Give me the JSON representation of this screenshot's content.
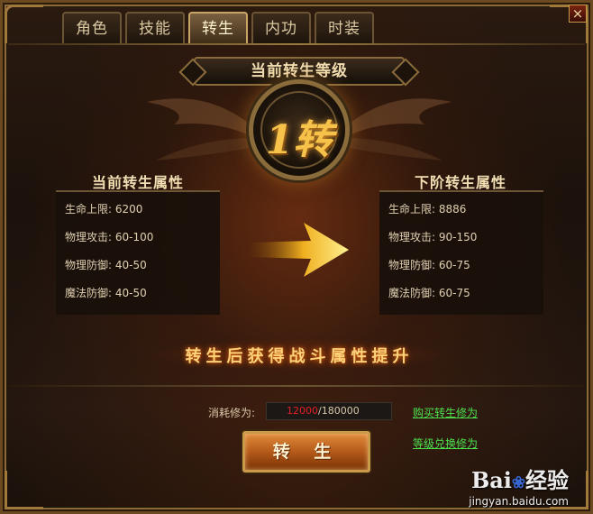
{
  "tabs": [
    "角色",
    "技能",
    "转生",
    "内功",
    "时装"
  ],
  "active_tab": 2,
  "close_label": "×",
  "title": "当前转生等级",
  "level_badge": "1转",
  "current": {
    "title": "当前转生属性",
    "stats": [
      "生命上限: 6200",
      "物理攻击: 60-100",
      "物理防御: 40-50",
      "魔法防御: 40-50"
    ]
  },
  "next": {
    "title": "下阶转生属性",
    "stats": [
      "生命上限: 8886",
      "物理攻击: 90-150",
      "物理防御: 60-75",
      "魔法防御: 60-75"
    ]
  },
  "bonus_text": "转生后获得战斗属性提升",
  "cost": {
    "label": "消耗修为:",
    "current": "12000",
    "max": "/180000"
  },
  "links": {
    "buy": "购买转生修为",
    "exchange": "等级兑换修为"
  },
  "button_label": "转 生",
  "watermark": {
    "logo": "Bai",
    "logo_suffix": "经验",
    "url": "jingyan.baidu.com"
  },
  "colors": {
    "accent_gold": "#c89a4a",
    "cost_current": "#e02020",
    "link_green": "#4de04d"
  }
}
